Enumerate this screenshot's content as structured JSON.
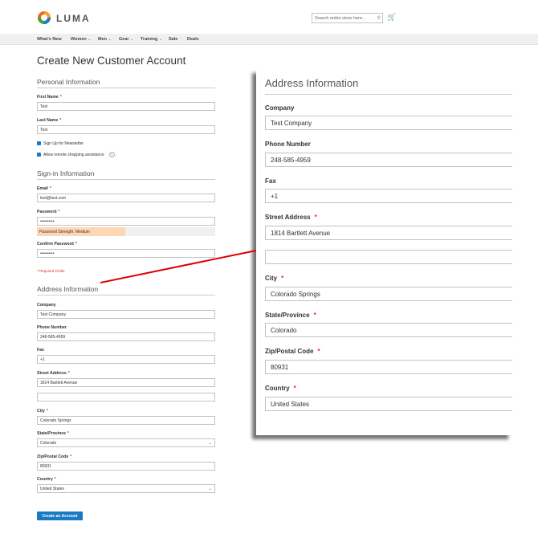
{
  "header": {
    "logo_text": "LUMA",
    "search_placeholder": "Search entire store here...",
    "search_icon": "magnifier-icon",
    "cart_icon": "cart-icon"
  },
  "nav": {
    "items": [
      {
        "label": "What's New",
        "has_dropdown": false
      },
      {
        "label": "Women",
        "has_dropdown": true
      },
      {
        "label": "Men",
        "has_dropdown": true
      },
      {
        "label": "Gear",
        "has_dropdown": true
      },
      {
        "label": "Training",
        "has_dropdown": true
      },
      {
        "label": "Sale",
        "has_dropdown": false
      },
      {
        "label": "Deals",
        "has_dropdown": false
      }
    ]
  },
  "page_title": "Create New Customer Account",
  "personal": {
    "title": "Personal Information",
    "first_name_label": "First Name",
    "first_name": "Test",
    "last_name_label": "Last Name",
    "last_name": "Test",
    "newsletter_label": "Sign Up for Newsletter",
    "newsletter_checked": true,
    "remote_label": "Allow remote shopping assistance",
    "remote_checked": true
  },
  "signin": {
    "title": "Sign-in Information",
    "email_label": "Email",
    "email": "test@test.com",
    "password_label": "Password",
    "password": "••••••••••",
    "strength_text": "Password Strength: Medium",
    "confirm_label": "Confirm Password",
    "confirm": "••••••••••",
    "required_note": "* Required Fields"
  },
  "address": {
    "title": "Address Information",
    "company_label": "Company",
    "company": "Test Company",
    "phone_label": "Phone Number",
    "phone": "248-585-4959",
    "fax_label": "Fax",
    "fax": "+1",
    "street_label": "Street Address",
    "street1": "1814 Bartlett Avenue",
    "street2": "",
    "city_label": "City",
    "city": "Colorado Springs",
    "state_label": "State/Province",
    "state": "Colorado",
    "zip_label": "Zip/Postal Code",
    "zip": "80931",
    "country_label": "Country",
    "country": "United States"
  },
  "submit_label": "Create an Account",
  "colors": {
    "accent": "#1979c3",
    "required": "#e02b27",
    "strength_medium": "#ffd6b3",
    "callout_arrow": "#e00000"
  }
}
